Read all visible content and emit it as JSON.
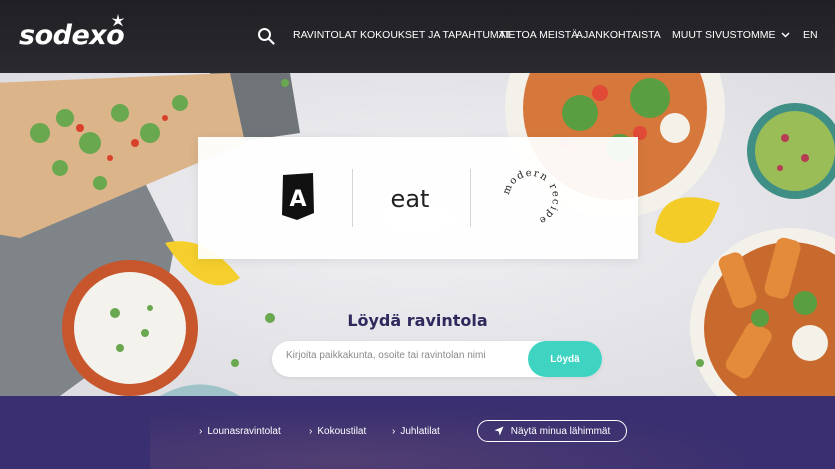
{
  "header": {
    "logo_text": "sodexo",
    "nav": [
      {
        "label": "RAVINTOLAT"
      },
      {
        "label": "KOKOUKSET JA TAPAHTUMAT"
      },
      {
        "label": "TIETOA MEISTÄ"
      },
      {
        "label": "AJANKOHTAISTA"
      }
    ],
    "more_label": "MUUT SIVUSTOMME",
    "lang_label": "EN",
    "icons": {
      "search": "search-icon",
      "more": "chevron-down-icon",
      "logo_mark": "star-icon"
    }
  },
  "hero": {
    "brands": [
      {
        "name": "A",
        "kind": "a-logo"
      },
      {
        "name": "eat",
        "kind": "eat-logo"
      },
      {
        "name": "modern recipe",
        "kind": "modern-recipe-logo"
      }
    ],
    "find_title": "Löydä ravintola",
    "search": {
      "placeholder": "Kirjoita paikkakunta, osoite tai ravintolan nimi",
      "button_label": "Löydä"
    }
  },
  "bottom_bar": {
    "links": [
      {
        "label": "Lounasravintolat"
      },
      {
        "label": "Kokoustilat"
      },
      {
        "label": "Juhlatilat"
      }
    ],
    "nearby_button": "Näytä minua lähimmät",
    "icons": {
      "link": "chevron-right-icon",
      "nearby": "location-arrow-icon"
    }
  },
  "colors": {
    "header_bg": "#222228",
    "accent_teal": "#3fd3c2",
    "bottom_bar_bg": "#3a2f70",
    "title_color": "#2e2a5e",
    "logo_star": "#e2231a"
  }
}
